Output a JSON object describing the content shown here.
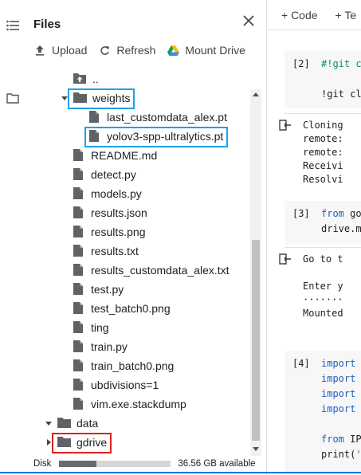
{
  "rail": {
    "items": [
      "table-of-contents-icon",
      "code-snippets-icon",
      "files-icon"
    ]
  },
  "panel": {
    "title": "Files",
    "actions": [
      {
        "label": "Upload",
        "icon": "upload-icon"
      },
      {
        "label": "Refresh",
        "icon": "refresh-icon"
      },
      {
        "label": "Mount Drive",
        "icon": "google-drive-icon"
      }
    ],
    "tree": [
      {
        "label": "..",
        "type": "parent",
        "depth": 1
      },
      {
        "label": "weights",
        "type": "folder",
        "depth": 1,
        "expanded": true,
        "highlight": "blue"
      },
      {
        "label": "last_customdata_alex.pt",
        "type": "file",
        "depth": 2
      },
      {
        "label": "yolov3-spp-ultralytics.pt",
        "type": "file",
        "depth": 2,
        "highlight": "blue"
      },
      {
        "label": "README.md",
        "type": "file",
        "depth": 1
      },
      {
        "label": "detect.py",
        "type": "file",
        "depth": 1
      },
      {
        "label": "models.py",
        "type": "file",
        "depth": 1
      },
      {
        "label": "results.json",
        "type": "file",
        "depth": 1
      },
      {
        "label": "results.png",
        "type": "file",
        "depth": 1
      },
      {
        "label": "results.txt",
        "type": "file",
        "depth": 1
      },
      {
        "label": "results_customdata_alex.txt",
        "type": "file",
        "depth": 1
      },
      {
        "label": "test.py",
        "type": "file",
        "depth": 1
      },
      {
        "label": "test_batch0.png",
        "type": "file",
        "depth": 1
      },
      {
        "label": "ting",
        "type": "file",
        "depth": 1
      },
      {
        "label": "train.py",
        "type": "file",
        "depth": 1
      },
      {
        "label": "train_batch0.png",
        "type": "file",
        "depth": 1
      },
      {
        "label": "ubdivisions=1",
        "type": "file",
        "depth": 1
      },
      {
        "label": "vim.exe.stackdump",
        "type": "file",
        "depth": 1
      },
      {
        "label": "data",
        "type": "folder",
        "depth": 0,
        "expanded": true
      },
      {
        "label": "gdrive",
        "type": "folder",
        "depth": 0,
        "expanded": false,
        "highlight": "red"
      }
    ],
    "disk": {
      "label": "Disk",
      "available": "36.56 GB available",
      "used_fraction": 0.33
    }
  },
  "notebook": {
    "toolbar": {
      "code_label": "+ Code",
      "text_label": "+ Te"
    },
    "cells": [
      {
        "exec": "[2]",
        "lines": [
          [
            {
              "t": "#!git c",
              "c": "green"
            }
          ],
          [],
          [
            {
              "t": "!git cl",
              "c": "dark"
            }
          ]
        ],
        "output": [
          "Cloning",
          "remote:",
          "remote:",
          "Receivi",
          "Resolvi"
        ]
      },
      {
        "exec": "[3]",
        "lines": [
          [
            {
              "t": "from ",
              "c": "blue"
            },
            {
              "t": "go",
              "c": "dark"
            }
          ],
          [
            {
              "t": "drive.m",
              "c": "dark"
            }
          ]
        ],
        "output": [
          "Go to t",
          "",
          "Enter y",
          "·······",
          "Mounted"
        ]
      },
      {
        "exec": "[4]",
        "lines": [
          [
            {
              "t": "import",
              "c": "blue"
            }
          ],
          [
            {
              "t": "import",
              "c": "blue"
            }
          ],
          [
            {
              "t": "import",
              "c": "blue"
            }
          ],
          [
            {
              "t": "import",
              "c": "blue"
            }
          ],
          [],
          [
            {
              "t": "from ",
              "c": "blue"
            },
            {
              "t": "IP",
              "c": "dark"
            }
          ],
          [
            {
              "t": "print(",
              "c": "dark"
            },
            {
              "t": "'",
              "c": "green"
            }
          ]
        ],
        "output": []
      }
    ]
  },
  "colors": {
    "highlight_blue": "#1ea1e6",
    "highlight_red": "#e0211d",
    "accent": "#1a73e8"
  }
}
